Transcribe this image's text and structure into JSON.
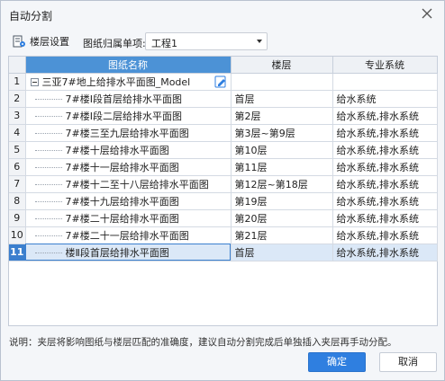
{
  "window": {
    "title": "自动分割"
  },
  "toolbar": {
    "floor_settings_label": "楼层设置",
    "owner_label": "图纸归属单项:",
    "owner_value": "工程1"
  },
  "table": {
    "headers": [
      "",
      "图纸名称",
      "楼层",
      "专业系统"
    ],
    "root": {
      "num": "1",
      "name": "三亚7#地上给排水平面图_Model",
      "floor": "",
      "system": ""
    },
    "rows": [
      {
        "num": "2",
        "name": "7#楼Ⅰ段首层给排水平面图",
        "floor": "首层",
        "system": "给水系统"
      },
      {
        "num": "3",
        "name": "7#楼Ⅰ段二层给排水平面图",
        "floor": "第2层",
        "system": "给水系统,排水系统"
      },
      {
        "num": "4",
        "name": "7#楼三至九层给排水平面图",
        "floor": "第3层~第9层",
        "system": "给水系统,排水系统"
      },
      {
        "num": "5",
        "name": "7#楼十层给排水平面图",
        "floor": "第10层",
        "system": "给水系统,排水系统"
      },
      {
        "num": "6",
        "name": "7#楼十一层给排水平面图",
        "floor": "第11层",
        "system": "给水系统,排水系统"
      },
      {
        "num": "7",
        "name": "7#楼十二至十八层给排水平面图",
        "floor": "第12层~第18层",
        "system": "给水系统,排水系统"
      },
      {
        "num": "8",
        "name": "7#楼十九层给排水平面图",
        "floor": "第19层",
        "system": "给水系统,排水系统"
      },
      {
        "num": "9",
        "name": "7#楼二十层给排水平面图",
        "floor": "第20层",
        "system": "给水系统,排水系统"
      },
      {
        "num": "10",
        "name": "7#楼二十一层给排水平面图",
        "floor": "第21层",
        "system": "给水系统,排水系统"
      },
      {
        "num": "11",
        "name": "楼Ⅱ段首层给排水平面图",
        "floor": "首层",
        "system": "给水系统,排水系统"
      }
    ]
  },
  "note": "说明：夹层将影响图纸与楼层匹配的准确度，建议自动分割完成后单独插入夹层再手动分配。",
  "buttons": {
    "ok": "确定",
    "cancel": "取消"
  },
  "colors": {
    "accent": "#2f7fe0",
    "header_highlight": "#4c92d6",
    "selected_row": "#dbe8f7"
  }
}
